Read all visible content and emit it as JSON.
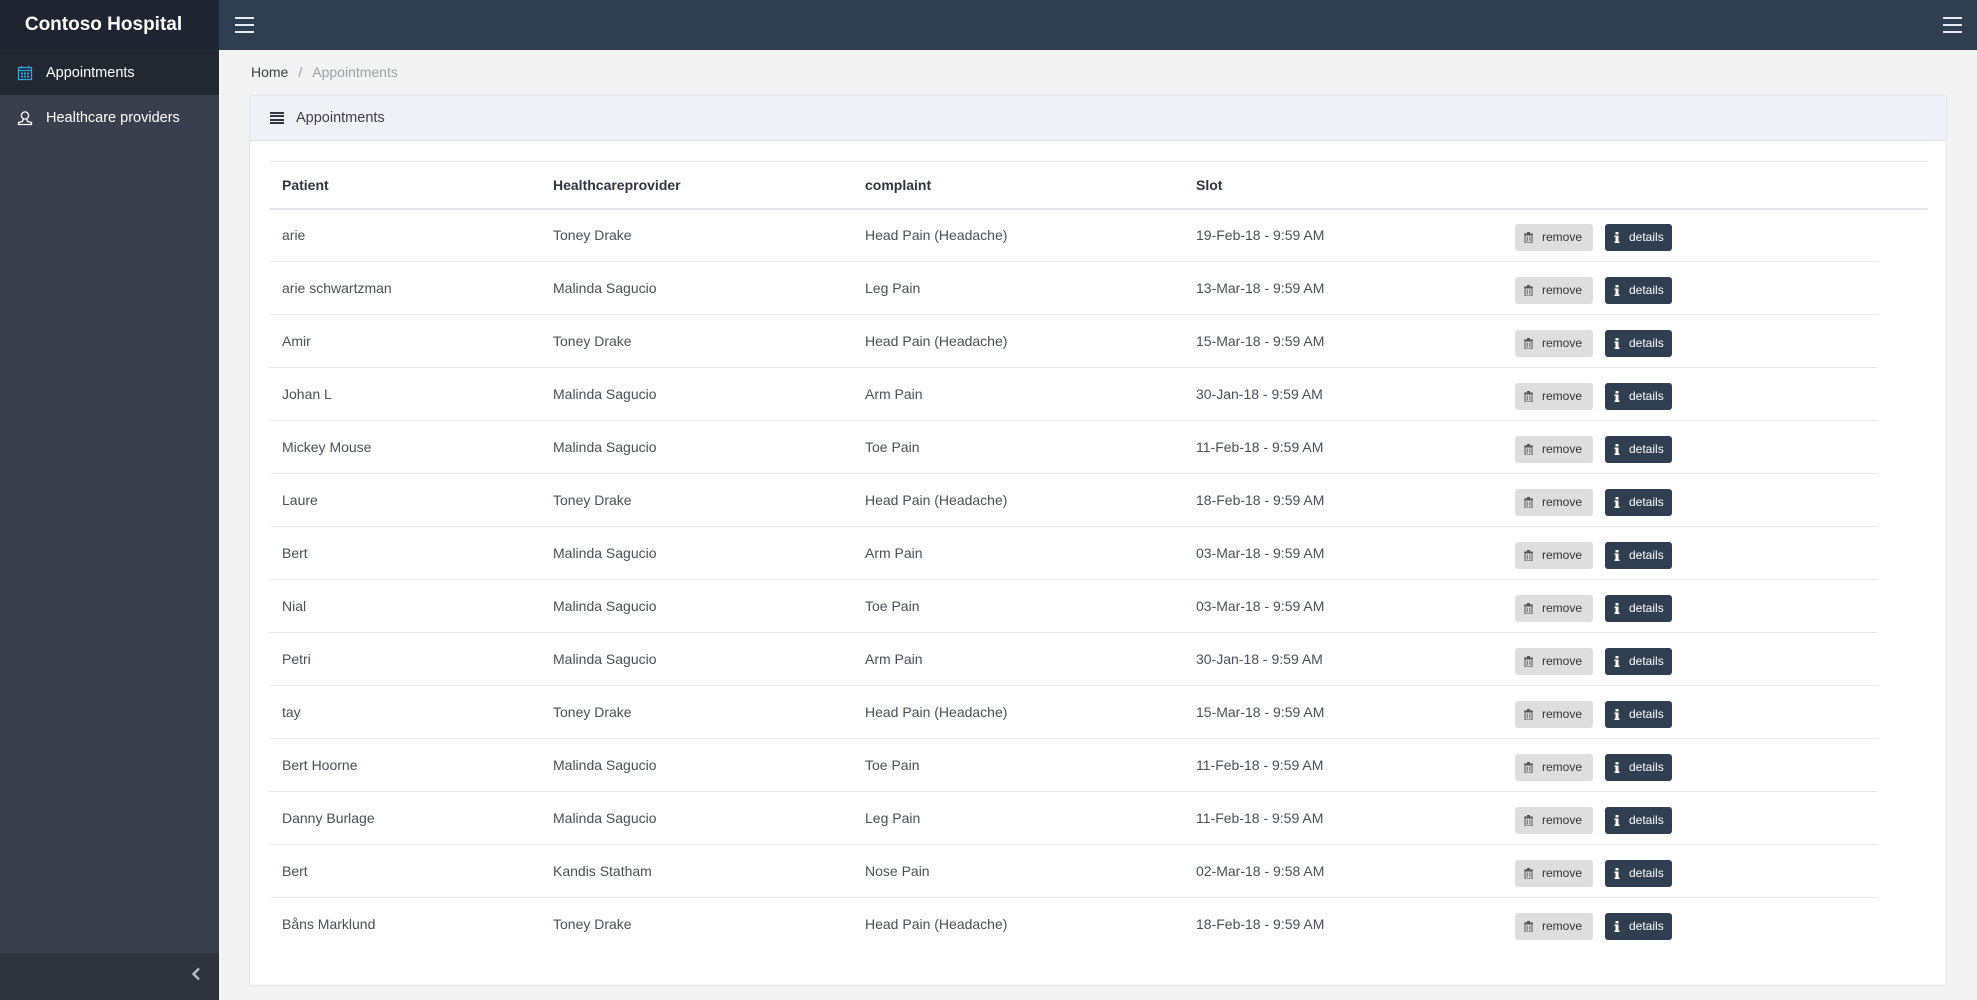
{
  "app": {
    "title": "Contoso Hospital"
  },
  "sidebar": {
    "items": [
      {
        "label": "Appointments",
        "icon": "calendar-icon",
        "active": true
      },
      {
        "label": "Healthcare providers",
        "icon": "user-icon",
        "active": false
      }
    ],
    "collapse_icon": "chevron-left-icon"
  },
  "topbar": {
    "left_icon": "hamburger-icon",
    "right_icon": "hamburger-icon"
  },
  "breadcrumb": {
    "home": "Home",
    "separator": "/",
    "current": "Appointments"
  },
  "panel": {
    "title": "Appointments",
    "icon": "list-icon",
    "table": {
      "columns": [
        "Patient",
        "Healthcareprovider",
        "complaint",
        "Slot",
        ""
      ],
      "rows": [
        {
          "patient": "arie",
          "provider": "Toney Drake",
          "complaint": "Head Pain (Headache)",
          "slot": "19-Feb-18 - 9:59 AM"
        },
        {
          "patient": "arie schwartzman",
          "provider": "Malinda Sagucio",
          "complaint": "Leg Pain",
          "slot": "13-Mar-18 - 9:59 AM"
        },
        {
          "patient": "Amir",
          "provider": "Toney Drake",
          "complaint": "Head Pain (Headache)",
          "slot": "15-Mar-18 - 9:59 AM"
        },
        {
          "patient": "Johan L",
          "provider": "Malinda Sagucio",
          "complaint": "Arm Pain",
          "slot": "30-Jan-18 - 9:59 AM"
        },
        {
          "patient": "Mickey Mouse",
          "provider": "Malinda Sagucio",
          "complaint": "Toe Pain",
          "slot": "11-Feb-18 - 9:59 AM"
        },
        {
          "patient": "Laure",
          "provider": "Toney Drake",
          "complaint": "Head Pain (Headache)",
          "slot": "18-Feb-18 - 9:59 AM"
        },
        {
          "patient": "Bert",
          "provider": "Malinda Sagucio",
          "complaint": "Arm Pain",
          "slot": "03-Mar-18 - 9:59 AM"
        },
        {
          "patient": "Nial",
          "provider": "Malinda Sagucio",
          "complaint": "Toe Pain",
          "slot": "03-Mar-18 - 9:59 AM"
        },
        {
          "patient": "Petri",
          "provider": "Malinda Sagucio",
          "complaint": "Arm Pain",
          "slot": "30-Jan-18 - 9:59 AM"
        },
        {
          "patient": "tay",
          "provider": "Toney Drake",
          "complaint": "Head Pain (Headache)",
          "slot": "15-Mar-18 - 9:59 AM"
        },
        {
          "patient": "Bert Hoorne",
          "provider": "Malinda Sagucio",
          "complaint": "Toe Pain",
          "slot": "11-Feb-18 - 9:59 AM"
        },
        {
          "patient": "Danny Burlage",
          "provider": "Malinda Sagucio",
          "complaint": "Leg Pain",
          "slot": "11-Feb-18 - 9:59 AM"
        },
        {
          "patient": "Bert",
          "provider": "Kandis Statham",
          "complaint": "Nose Pain",
          "slot": "02-Mar-18 - 9:58 AM"
        },
        {
          "patient": "Båns Marklund",
          "provider": "Toney Drake",
          "complaint": "Head Pain (Headache)",
          "slot": "18-Feb-18 - 9:59 AM"
        }
      ],
      "actions": {
        "remove_label": "remove",
        "remove_icon": "trash-icon",
        "details_label": "details",
        "details_icon": "info-icon"
      }
    }
  },
  "colors": {
    "topbar": "#2f3e51",
    "sidebar": "#3a3f4e",
    "sidebar_active": "#222831",
    "brand_bg": "#1e2430",
    "accent_icon": "#2ea3dc",
    "details_button": "#2f3e51",
    "remove_button": "#dedede"
  }
}
